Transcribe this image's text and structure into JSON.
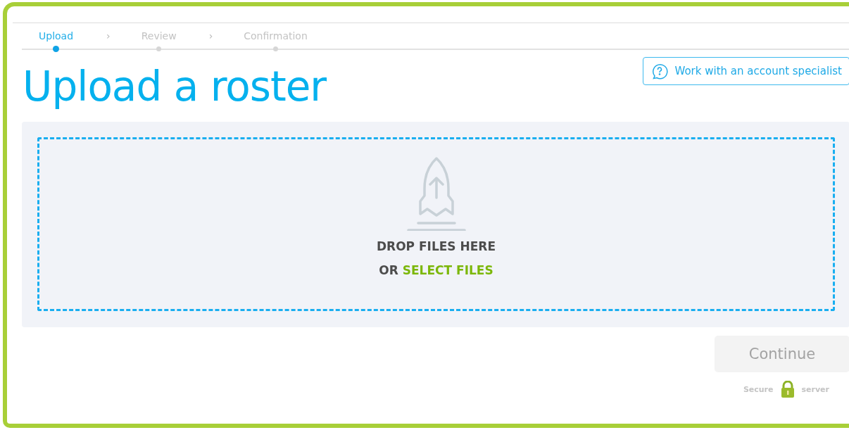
{
  "stepper": {
    "steps": [
      {
        "label": "Upload",
        "selected": true
      },
      {
        "label": "Review",
        "selected": false
      },
      {
        "label": "Confirmation",
        "selected": false
      }
    ],
    "separator": "›"
  },
  "title": "Upload a roster",
  "specialist_button": {
    "label": "Work with an account specialist"
  },
  "dropzone": {
    "prompt": "DROP FILES HERE",
    "or_text": "OR",
    "select_link": "SELECT FILES"
  },
  "continue_button": {
    "label": "Continue",
    "disabled": true
  },
  "secure": {
    "left": "Secure",
    "right": "server"
  }
}
